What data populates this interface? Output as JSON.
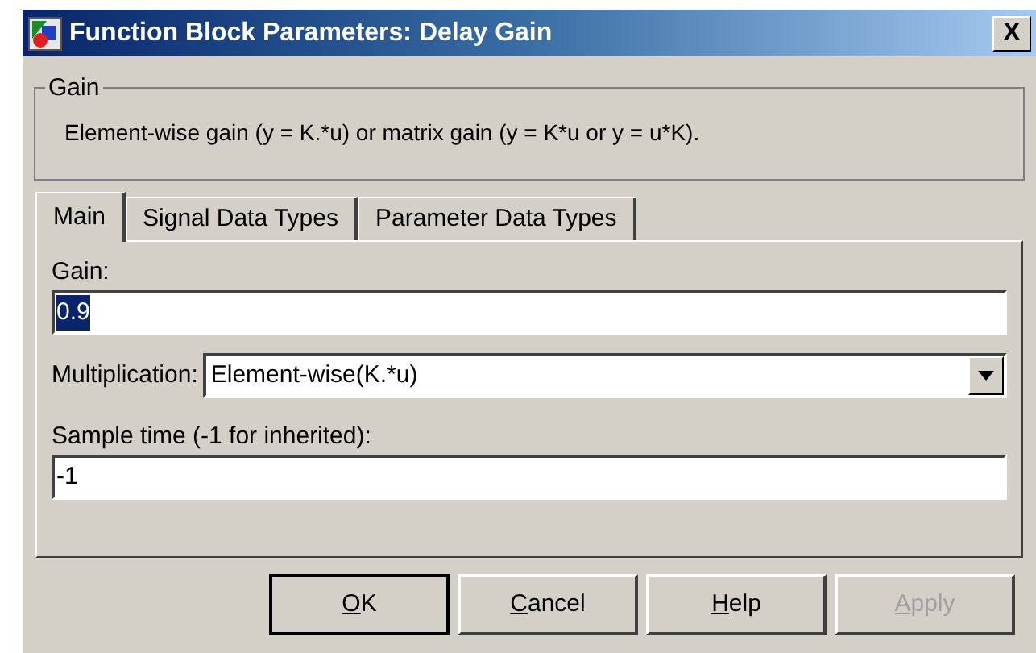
{
  "window": {
    "title": "Function Block Parameters: Delay Gain",
    "close": "X"
  },
  "group": {
    "title": "Gain",
    "description": "Element-wise gain (y = K.*u) or matrix gain (y = K*u or y = u*K)."
  },
  "tabs": [
    {
      "label": "Main",
      "selected": true
    },
    {
      "label": "Signal Data Types",
      "selected": false
    },
    {
      "label": "Parameter Data Types",
      "selected": false
    }
  ],
  "fields": [
    {
      "kind": "text",
      "label": "Gain:",
      "value": "0.9",
      "selected": true
    },
    {
      "kind": "dropdown",
      "label": "Multiplication:",
      "value": "Element-wise(K.*u)"
    },
    {
      "kind": "text",
      "label": "Sample time (-1 for inherited):",
      "value": "-1",
      "selected": false
    }
  ],
  "buttons": [
    {
      "underlined": "O",
      "rest": "K",
      "disabled": false,
      "default": true
    },
    {
      "underlined": "C",
      "rest": "ancel",
      "disabled": false,
      "default": false
    },
    {
      "underlined": "H",
      "rest": "elp",
      "disabled": false,
      "default": false
    },
    {
      "underlined": "A",
      "rest": "pply",
      "disabled": true,
      "default": false
    }
  ]
}
